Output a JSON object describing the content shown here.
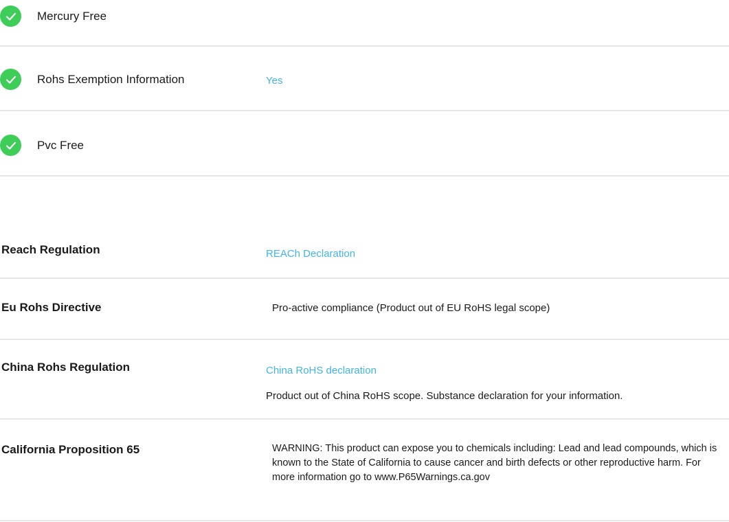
{
  "features": [
    {
      "label": "Mercury Free",
      "value": "",
      "icon": "check-circle-icon"
    },
    {
      "label": "Rohs Exemption Information",
      "value": "Yes",
      "icon": "check-circle-icon"
    },
    {
      "label": "Pvc Free",
      "value": "",
      "icon": "check-circle-icon"
    }
  ],
  "regulations": {
    "reach": {
      "label": "Reach Regulation",
      "link": "REACh Declaration"
    },
    "eu_rohs": {
      "label": "Eu Rohs Directive",
      "value": "Pro-active compliance (Product out of EU RoHS legal scope)"
    },
    "china_rohs": {
      "label": "China Rohs Regulation",
      "link": "China RoHS declaration",
      "note": "Product out of China RoHS scope. Substance declaration for your information."
    },
    "california": {
      "label": "California Proposition 65",
      "warning": "WARNING: This product can expose you to chemicals including: Lead and lead compounds, which is known to the State of California to cause cancer and birth defects or other reproductive harm. For more information go to www.P65Warnings.ca.gov"
    }
  },
  "colors": {
    "check": "#3dcd58",
    "link": "#42b4e6",
    "divider": "#e6e6e6"
  }
}
